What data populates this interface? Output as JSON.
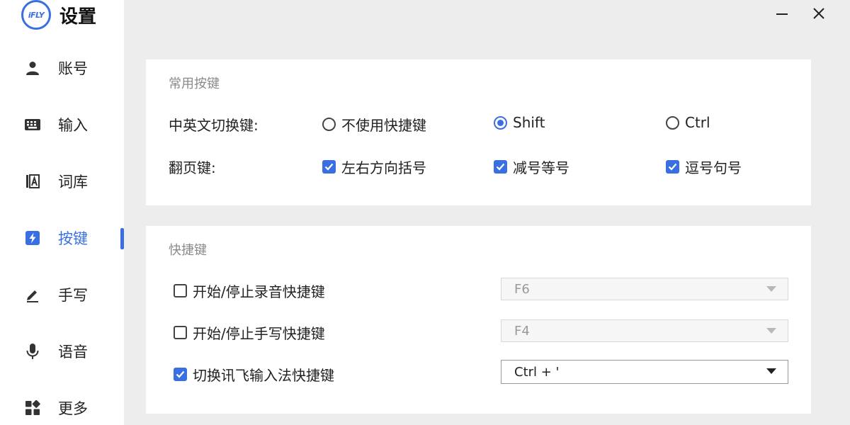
{
  "app": {
    "logo_text": "iFLY",
    "title": "设置"
  },
  "sidebar": {
    "items": [
      {
        "label": "账号",
        "icon": "user-icon"
      },
      {
        "label": "输入",
        "icon": "keyboard-icon"
      },
      {
        "label": "词库",
        "icon": "dictionary-icon"
      },
      {
        "label": "按键",
        "icon": "lightning-icon",
        "active": true
      },
      {
        "label": "手写",
        "icon": "pen-icon"
      },
      {
        "label": "语音",
        "icon": "microphone-icon"
      },
      {
        "label": "更多",
        "icon": "grid-icon"
      }
    ]
  },
  "window": {
    "minimize_icon": "minimize-icon",
    "close_icon": "close-icon"
  },
  "common_keys": {
    "title": "常用按键",
    "switch_label": "中英文切换键:",
    "switch_options": [
      {
        "label": "不使用快捷键",
        "checked": false
      },
      {
        "label": "Shift",
        "checked": true
      },
      {
        "label": "Ctrl",
        "checked": false
      }
    ],
    "page_label": "翻页键:",
    "page_options": [
      {
        "label": "左右方向括号",
        "checked": true
      },
      {
        "label": "减号等号",
        "checked": true
      },
      {
        "label": "逗号句号",
        "checked": true
      }
    ]
  },
  "shortcuts": {
    "title": "快捷键",
    "rows": [
      {
        "label": "开始/停止录音快捷键",
        "checked": false,
        "value": "F6"
      },
      {
        "label": "开始/停止手写快捷键",
        "checked": false,
        "value": "F4"
      },
      {
        "label": "切换讯飞输入法快捷键",
        "checked": true,
        "value": "Ctrl + '"
      }
    ]
  },
  "colors": {
    "accent": "#3a6fe2",
    "background": "#ededed",
    "panel": "#ffffff"
  }
}
